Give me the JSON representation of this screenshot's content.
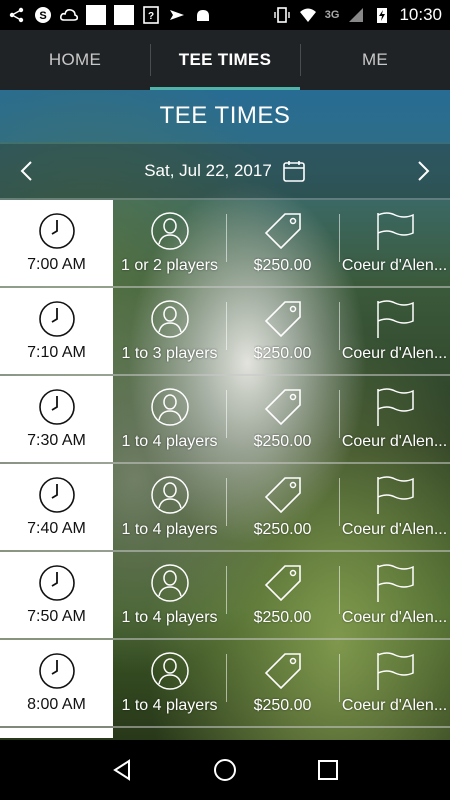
{
  "status_bar": {
    "time": "10:30",
    "network": "3G"
  },
  "tabs": [
    {
      "label": "HOME"
    },
    {
      "label": "TEE TIMES"
    },
    {
      "label": "ME"
    }
  ],
  "header": {
    "title": "TEE TIMES"
  },
  "date_bar": {
    "date": "Sat, Jul 22, 2017"
  },
  "tee_times": [
    {
      "time": "7:00 AM",
      "players": "1 or 2 players",
      "price": "$250.00",
      "course": "Coeur d'Alen..."
    },
    {
      "time": "7:10 AM",
      "players": "1 to 3 players",
      "price": "$250.00",
      "course": "Coeur d'Alen..."
    },
    {
      "time": "7:30 AM",
      "players": "1 to 4 players",
      "price": "$250.00",
      "course": "Coeur d'Alen..."
    },
    {
      "time": "7:40 AM",
      "players": "1 to 4 players",
      "price": "$250.00",
      "course": "Coeur d'Alen..."
    },
    {
      "time": "7:50 AM",
      "players": "1 to 4 players",
      "price": "$250.00",
      "course": "Coeur d'Alen..."
    },
    {
      "time": "8:00 AM",
      "players": "1 to 4 players",
      "price": "$250.00",
      "course": "Coeur d'Alen..."
    }
  ],
  "colors": {
    "tab_bar": "#202326",
    "active_tab_underline": "#4fb3a9",
    "time_cell_bg": "#ffffff"
  }
}
